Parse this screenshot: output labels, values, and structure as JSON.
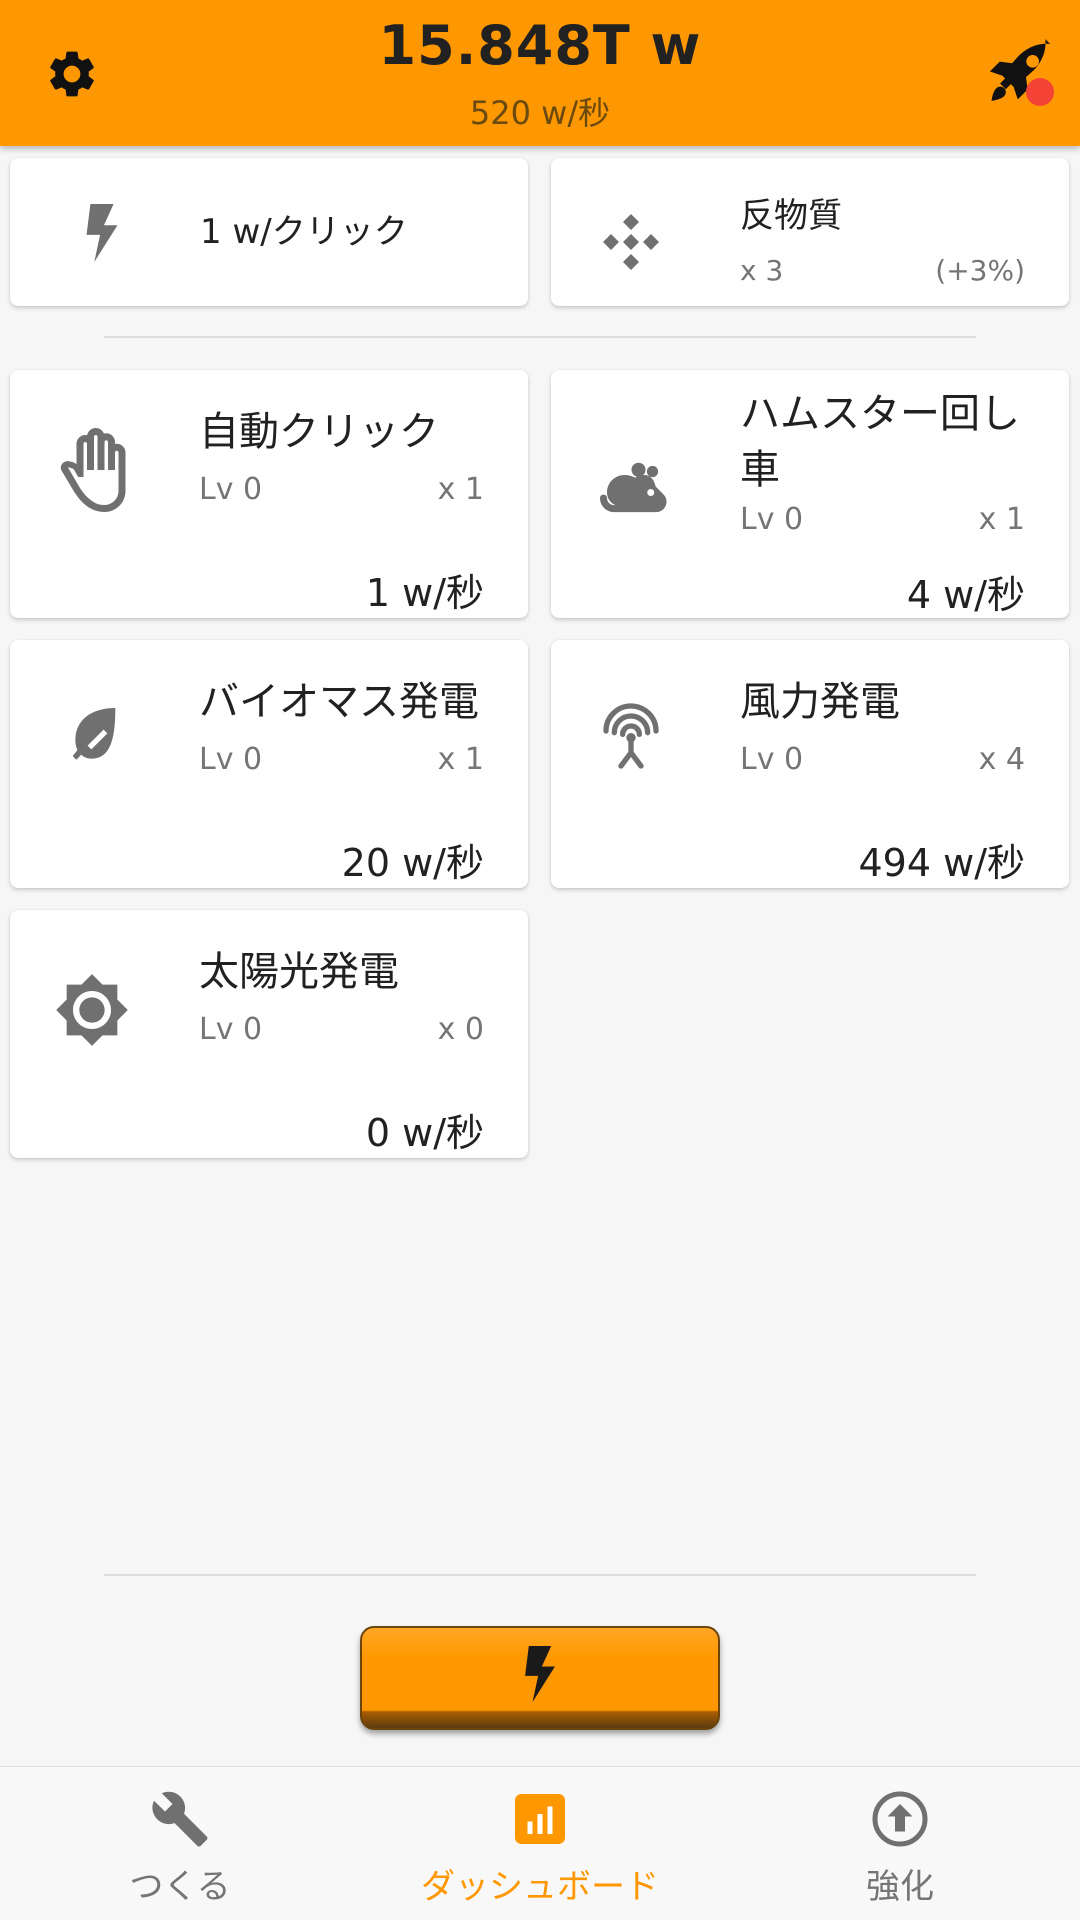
{
  "header": {
    "total_power": "15.848T w",
    "rate": "520 w/秒"
  },
  "click_card": {
    "label": "1 w/クリック",
    "icon": "bolt-icon"
  },
  "antimatter_card": {
    "name": "反物質",
    "count": "x 3",
    "bonus": "(+3%)",
    "icon": "antimatter-icon"
  },
  "generators": [
    {
      "name": "自動クリック",
      "level": "Lv 0",
      "count": "x 1",
      "rate": "1 w/秒",
      "icon": "hand-icon"
    },
    {
      "name": "ハムスター回し車",
      "level": "Lv 0",
      "count": "x 1",
      "rate": "4 w/秒",
      "icon": "rodent-icon"
    },
    {
      "name": "バイオマス発電",
      "level": "Lv 0",
      "count": "x 1",
      "rate": "20 w/秒",
      "icon": "leaf-icon"
    },
    {
      "name": "風力発電",
      "level": "Lv 0",
      "count": "x 4",
      "rate": "494 w/秒",
      "icon": "wind-tower-icon"
    },
    {
      "name": "太陽光発電",
      "level": "Lv 0",
      "count": "x 0",
      "rate": "0 w/秒",
      "icon": "sun-icon"
    }
  ],
  "bottom_nav": [
    {
      "label": "つくる",
      "icon": "wrench-icon",
      "active": false
    },
    {
      "label": "ダッシュボード",
      "icon": "dashboard-icon",
      "active": true
    },
    {
      "label": "強化",
      "icon": "upgrade-icon",
      "active": false
    }
  ],
  "colors": {
    "accent": "#ff9800",
    "icon_gray": "#707070",
    "notification": "#f44336"
  }
}
